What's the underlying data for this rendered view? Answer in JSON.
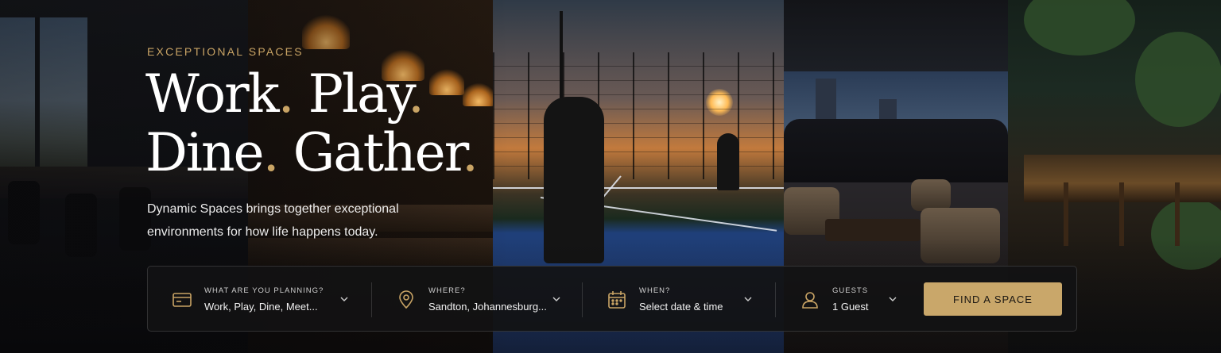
{
  "hero": {
    "eyebrow": "EXCEPTIONAL SPACES",
    "headline": {
      "line1_word1": "Work",
      "line1_word2": "Play",
      "line2_word1": "Dine",
      "line2_word2": "Gather",
      "dot": "."
    },
    "subtitle": "Dynamic Spaces brings together exceptional environments for how life happens today."
  },
  "search": {
    "fields": [
      {
        "label": "WHAT ARE YOU PLANNING?",
        "value": "Work, Play, Dine, Meet...",
        "icon": "card-icon"
      },
      {
        "label": "WHERE?",
        "value": "Sandton, Johannesburg...",
        "icon": "location-pin-icon"
      },
      {
        "label": "WHEN?",
        "value": "Select date & time",
        "icon": "calendar-icon"
      },
      {
        "label": "GUESTS",
        "value": "1 Guest",
        "icon": "user-icon"
      }
    ],
    "button_label": "FIND A SPACE"
  },
  "colors": {
    "accent": "#c9a465",
    "button": "#c9a76a",
    "panel_bg": "#121214"
  }
}
